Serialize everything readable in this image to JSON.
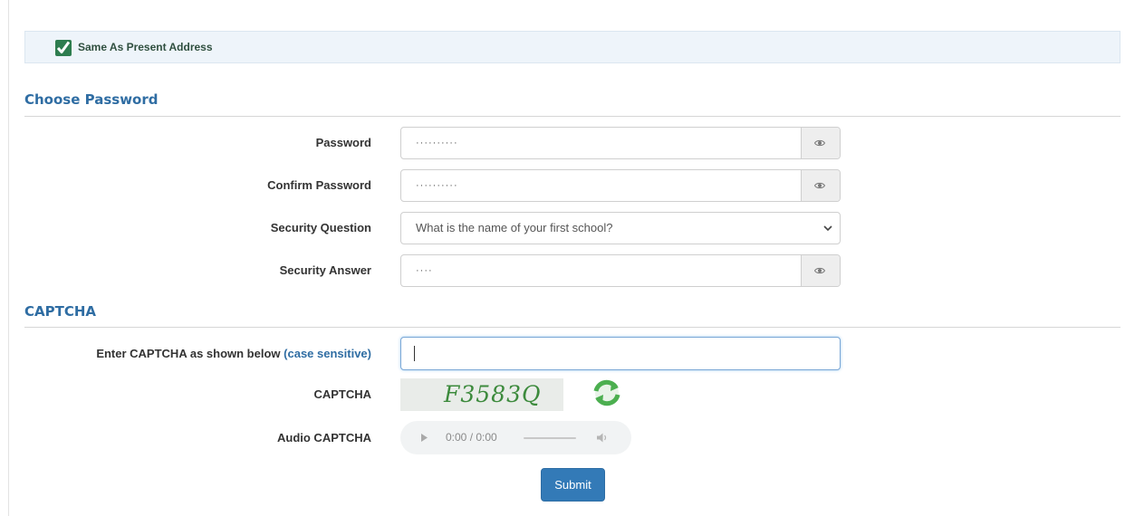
{
  "address": {
    "same_as_label": "Same As Present Address",
    "same_as_checked": true
  },
  "password_section": {
    "title": "Choose Password",
    "fields": {
      "password": {
        "label": "Password",
        "value": "··········"
      },
      "confirm_password": {
        "label": "Confirm Password",
        "value": "··········"
      },
      "security_question": {
        "label": "Security Question",
        "value": "What is the name of your first school?"
      },
      "security_answer": {
        "label": "Security Answer",
        "value": "····"
      }
    }
  },
  "captcha_section": {
    "title": "CAPTCHA",
    "enter_label": "Enter CAPTCHA as shown below",
    "enter_hint": "(case sensitive)",
    "input_value": "",
    "captcha_label": "CAPTCHA",
    "captcha_text": "F3583Q",
    "audio_label": "Audio CAPTCHA",
    "audio_time": "0:00 / 0:00"
  },
  "submit_label": "Submit",
  "icons": {
    "checkbox": "checkmark-icon",
    "toggle": "eye-icon",
    "dropdown": "chevron-down-icon",
    "refresh": "refresh-icon",
    "play": "play-icon",
    "volume": "volume-icon"
  },
  "colors": {
    "accent": "#337ab7",
    "section_title": "#2f6da3",
    "checkbox": "#2e7d4f",
    "captcha_text": "#3c8a3c"
  }
}
